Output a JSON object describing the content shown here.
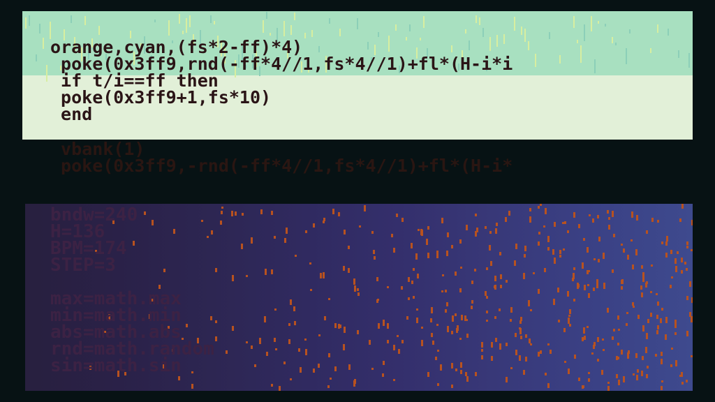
{
  "editor": {
    "visible_lines": [
      "orange,cyan,(fs*2-ff)*4)",
      " poke(0x3ff9,rnd(-ff*4//1,fs*4//1)+fl*(H-i*i",
      " if t/i==ff then",
      " poke(0x3ff9+1,fs*10)",
      " end"
    ],
    "ghost_lines": [
      " vbank(1)",
      " poke(0x3ff9,-rnd(-ff*4//1,fs*4//1)+fl*(H-i*"
    ]
  },
  "background_code": {
    "lines": [
      "bndw=240",
      "H=136",
      "BPM=174",
      "STEP=3",
      "",
      "max=math.max",
      "min=math.min",
      "abs=math.abs",
      "rnd=math.random",
      "sin=math.sin"
    ]
  },
  "colors": {
    "panel_top": "#a8e0c0",
    "panel_bottom": "#e2f0d8",
    "code_text": "#2a1416",
    "background": "#071214",
    "drip_orange": "#b8521f"
  }
}
